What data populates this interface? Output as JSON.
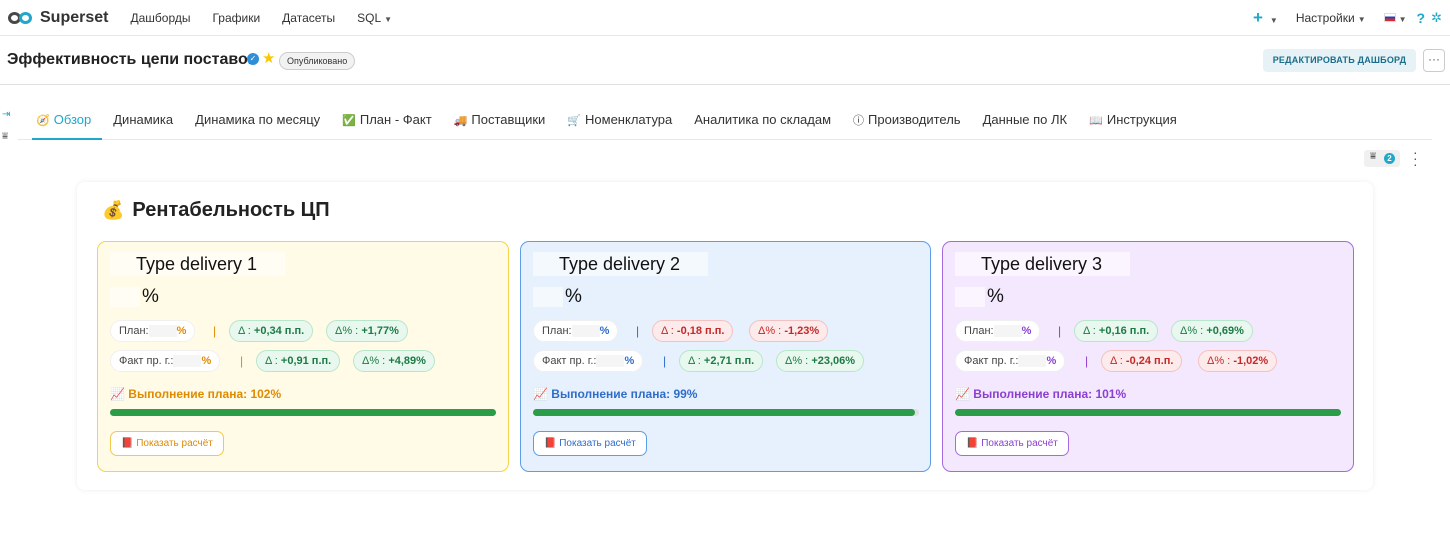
{
  "nav": {
    "logo": "Superset",
    "items": [
      "Дашборды",
      "Графики",
      "Датасеты",
      "SQL"
    ],
    "right": {
      "plus": "+",
      "settings": "Настройки",
      "help": "?"
    }
  },
  "header": {
    "title": "Эффективность цепи поставок",
    "status": "Опубликовано",
    "edit": "РЕДАКТИРОВАТЬ ДАШБОРД",
    "more": "···"
  },
  "tabs": [
    {
      "icon": "🧭",
      "label": "Обзор",
      "active": true
    },
    {
      "icon": "",
      "label": "Динамика"
    },
    {
      "icon": "",
      "label": "Динамика по месяцу"
    },
    {
      "icon": "✅",
      "label": "План - Факт"
    },
    {
      "icon": "🚚",
      "label": "Поставщики"
    },
    {
      "icon": "🛒",
      "label": "Номенклатура"
    },
    {
      "icon": "",
      "label": "Аналитика по складам"
    },
    {
      "icon": "ⓘ",
      "label": "Производитель"
    },
    {
      "icon": "",
      "label": "Данные по ЛК"
    },
    {
      "icon": "📖",
      "label": "Инструкция"
    }
  ],
  "filters": {
    "count": "2"
  },
  "card": {
    "emoji": "💰",
    "title": "Рентабельность ЦП",
    "deliveries": [
      {
        "name": "Type delivery 1",
        "pct_sign": "%",
        "plan_label": "План:",
        "fact_label": "Факт пр. г.:",
        "plan_delta_pp": {
          "label": "Δ :",
          "value": "+0,34 п.п."
        },
        "plan_delta_pct": {
          "label": "Δ% :",
          "value": "+1,77%"
        },
        "fact_delta_pp": {
          "label": "Δ :",
          "value": "+0,91 п.п."
        },
        "fact_delta_pct": {
          "label": "Δ% :",
          "value": "+4,89%"
        },
        "fulfillment": "📈 Выполнение плана: 102%",
        "progress": 1.0,
        "button": "📕 Показать расчёт",
        "colors": {
          "bg": "#fffbe6",
          "border": "#f2d34e",
          "accent": "#e08a00"
        }
      },
      {
        "name": "Type delivery 2",
        "pct_sign": "%",
        "plan_label": "План:",
        "fact_label": "Факт пр. г.:",
        "plan_delta_pp": {
          "label": "Δ :",
          "value": "-0,18 п.п."
        },
        "plan_delta_pct": {
          "label": "Δ% :",
          "value": "-1,23%"
        },
        "fact_delta_pp": {
          "label": "Δ :",
          "value": "+2,71 п.п."
        },
        "fact_delta_pct": {
          "label": "Δ% :",
          "value": "+23,06%"
        },
        "fulfillment": "📈 Выполнение плана: 99%",
        "progress": 0.99,
        "button": "📕 Показать расчёт",
        "colors": {
          "bg": "#e6f1fd",
          "border": "#5b9ee6",
          "accent": "#2f6dc9"
        }
      },
      {
        "name": "Type delivery 3",
        "pct_sign": "%",
        "plan_label": "План:",
        "fact_label": "Факт пр. г.:",
        "plan_delta_pp": {
          "label": "Δ :",
          "value": "+0,16 п.п."
        },
        "plan_delta_pct": {
          "label": "Δ% :",
          "value": "+0,69%"
        },
        "fact_delta_pp": {
          "label": "Δ :",
          "value": "-0,24 п.п."
        },
        "fact_delta_pct": {
          "label": "Δ% :",
          "value": "-1,02%"
        },
        "fulfillment": "📈 Выполнение плана: 101%",
        "progress": 1.0,
        "button": "📕 Показать расчёт",
        "colors": {
          "bg": "#f3e8fd",
          "border": "#a46be0",
          "accent": "#8a3fd1"
        }
      }
    ]
  }
}
